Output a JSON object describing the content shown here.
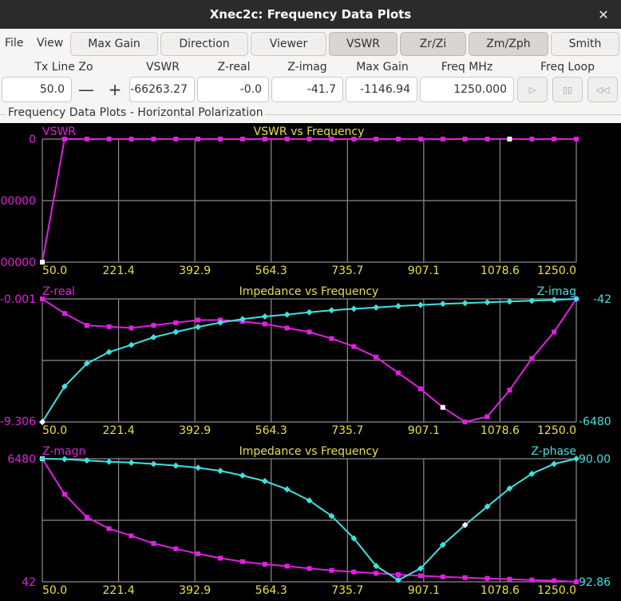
{
  "window": {
    "title": "Xnec2c: Frequency Data Plots",
    "close_glyph": "✕"
  },
  "menu": {
    "file": "File",
    "view": "View"
  },
  "toolbar": {
    "buttons": [
      {
        "label": "Max Gain",
        "active": false
      },
      {
        "label": "Direction",
        "active": false
      },
      {
        "label": "Viewer",
        "active": false
      },
      {
        "label": "VSWR",
        "active": true
      },
      {
        "label": "Zr/Zi",
        "active": true
      },
      {
        "label": "Zm/Zph",
        "active": true
      },
      {
        "label": "Smith",
        "active": false
      }
    ]
  },
  "fields": {
    "tx_line_zo": {
      "label": "Tx Line Zo",
      "value": "50.0",
      "minus": "—",
      "plus": "+"
    },
    "vswr": {
      "label": "VSWR",
      "value": "-66263.27"
    },
    "z_real": {
      "label": "Z-real",
      "value": "-0.0"
    },
    "z_imag": {
      "label": "Z-imag",
      "value": "-41.7"
    },
    "max_gain": {
      "label": "Max Gain",
      "value": "-1146.94"
    },
    "freq": {
      "label": "Freq MHz",
      "value": "1250.000"
    },
    "freq_loop": {
      "label": "Freq Loop",
      "play": "▷",
      "pause": "▯▯",
      "rewind": "◁◁"
    }
  },
  "frame": {
    "label": "Frequency Data Plots - Horizontal Polarization"
  },
  "colors": {
    "magenta": "#e020e0",
    "cyan": "#40e0e0",
    "yellow": "#e8e040",
    "grid": "#8c8c8c",
    "white": "#ffffff"
  },
  "chart_data": [
    {
      "type": "line",
      "title": "VSWR vs Frequency",
      "left_label": "VSWR",
      "x_ticks": [
        "50.0",
        "221.4",
        "392.9",
        "564.3",
        "735.7",
        "907.1",
        "1078.6",
        "1250.0"
      ],
      "y_ticks_left": [
        "0",
        "00000",
        "00000"
      ],
      "x": [
        50,
        100,
        150,
        200,
        250,
        300,
        350,
        400,
        450,
        500,
        550,
        600,
        650,
        700,
        750,
        800,
        850,
        900,
        950,
        1000,
        1050,
        1100,
        1150,
        1200,
        1250
      ],
      "series": [
        {
          "values": [
            0,
            1,
            1,
            1,
            1,
            1,
            1,
            1,
            1,
            1,
            1,
            1,
            1,
            1,
            1,
            1,
            1,
            1,
            1,
            1,
            1,
            1,
            1,
            1,
            1
          ]
        }
      ],
      "ylim": [
        0,
        1
      ],
      "marker_index": 21
    },
    {
      "type": "line",
      "title": "Impedance vs Frequency",
      "left_label": "Z-real",
      "right_label": "Z-imag",
      "x_ticks": [
        "50.0",
        "221.4",
        "392.9",
        "564.3",
        "735.7",
        "907.1",
        "1078.6",
        "1250.0"
      ],
      "y_ticks_left": [
        "-0.001",
        "-9.306"
      ],
      "y_ticks_right": [
        "-42",
        "-6480"
      ],
      "x": [
        50,
        100,
        150,
        200,
        250,
        300,
        350,
        400,
        450,
        500,
        550,
        600,
        650,
        700,
        750,
        800,
        850,
        900,
        950,
        1000,
        1050,
        1100,
        1150,
        1200,
        1250
      ],
      "series": [
        {
          "name": "Z-real",
          "axis": "left",
          "values": [
            0.0,
            1.1,
            2.0,
            2.1,
            2.2,
            2.0,
            1.8,
            1.6,
            1.6,
            1.7,
            1.9,
            2.2,
            2.5,
            3.0,
            3.6,
            4.4,
            5.6,
            6.8,
            8.2,
            9.3,
            8.9,
            6.9,
            4.5,
            2.5,
            0.0
          ]
        },
        {
          "name": "Z-imag",
          "axis": "right",
          "values": [
            -6480,
            -4620,
            -3420,
            -2820,
            -2450,
            -2050,
            -1770,
            -1510,
            -1280,
            -1100,
            -960,
            -860,
            -740,
            -640,
            -560,
            -490,
            -420,
            -360,
            -300,
            -260,
            -220,
            -180,
            -140,
            -100,
            -42
          ]
        }
      ],
      "ylim_left": [
        0,
        9.306
      ],
      "ylim_right": [
        -6480,
        -42
      ]
    },
    {
      "type": "line",
      "title": "Impedance vs Frequency",
      "left_label": "Z-magn",
      "right_label": "Z-phase",
      "x_ticks": [
        "50.0",
        "221.4",
        "392.9",
        "564.3",
        "735.7",
        "907.1",
        "1078.6",
        "1250.0"
      ],
      "y_ticks_left": [
        "6480",
        "42"
      ],
      "y_ticks_right": [
        "90.00",
        "92.86"
      ],
      "x": [
        50,
        100,
        150,
        200,
        250,
        300,
        350,
        400,
        450,
        500,
        550,
        600,
        650,
        700,
        750,
        800,
        850,
        900,
        950,
        1000,
        1050,
        1100,
        1150,
        1200,
        1250
      ],
      "series": [
        {
          "name": "Z-magn",
          "axis": "left",
          "values": [
            6480,
            4620,
            3420,
            2820,
            2450,
            2050,
            1770,
            1510,
            1280,
            1100,
            960,
            860,
            740,
            640,
            560,
            490,
            420,
            360,
            300,
            260,
            220,
            180,
            140,
            100,
            42
          ]
        },
        {
          "name": "Z-phase",
          "axis": "right",
          "values": [
            90.0,
            90.01,
            90.04,
            90.07,
            90.09,
            90.12,
            90.16,
            90.21,
            90.28,
            90.39,
            90.52,
            90.71,
            90.97,
            91.33,
            91.85,
            92.49,
            92.82,
            92.55,
            92.0,
            91.54,
            91.11,
            90.69,
            90.35,
            90.12,
            90.0
          ]
        }
      ],
      "ylim_left": [
        42,
        6480
      ],
      "ylim_right": [
        90.0,
        92.86
      ],
      "right_inverted": true
    }
  ]
}
